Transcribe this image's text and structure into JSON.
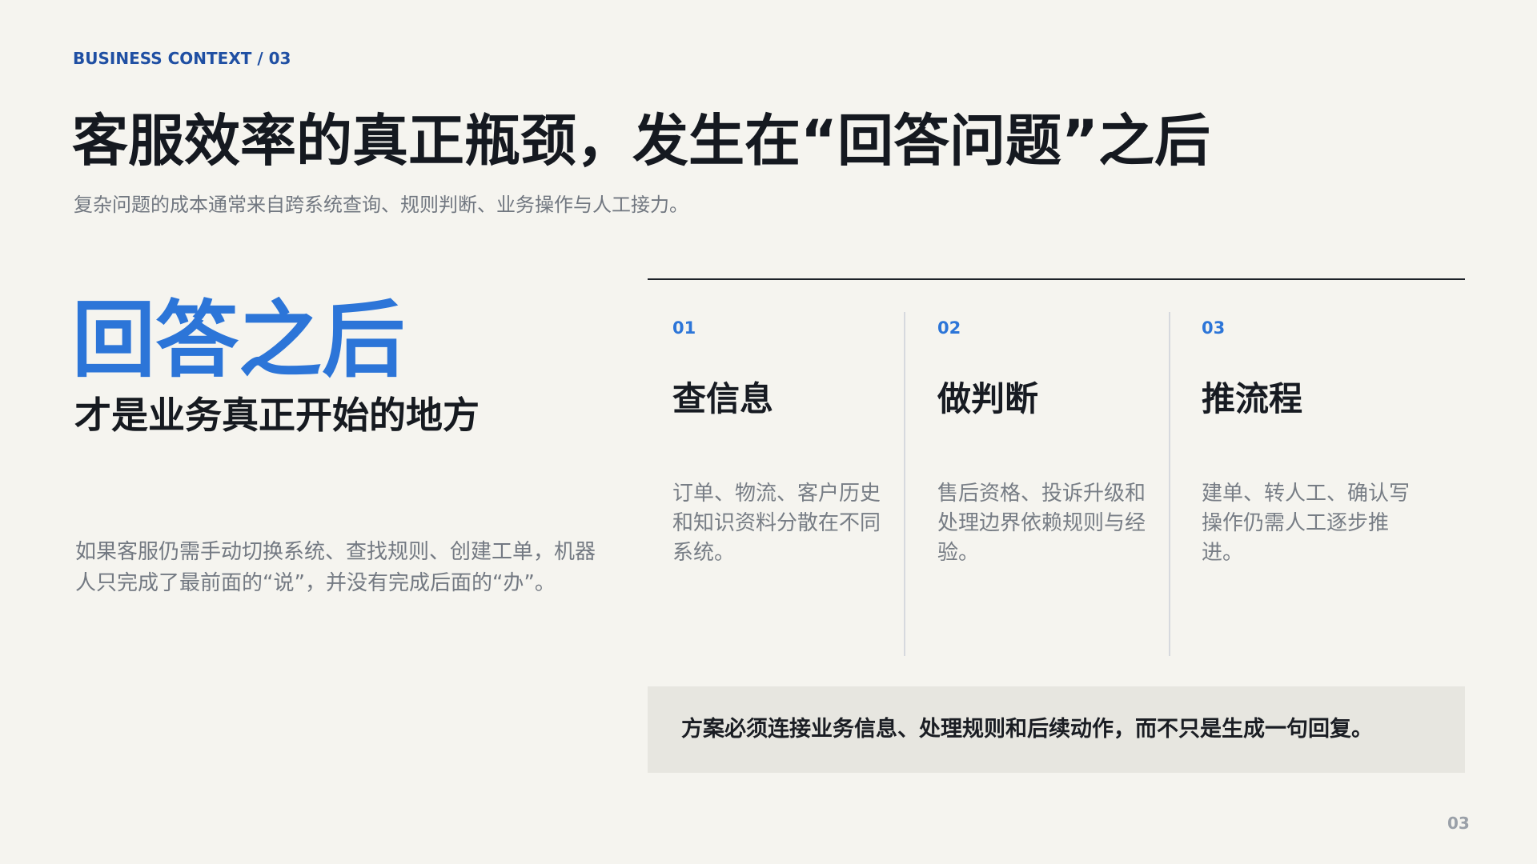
{
  "header": {
    "eyebrow": "BUSINESS CONTEXT / 03",
    "title": "客服效率的真正瓶颈，发生在“回答问题”之后",
    "subtitle": "复杂问题的成本通常来自跨系统查询、规则判断、业务操作与人工接力。"
  },
  "left_panel": {
    "highlight": "回答之后",
    "subheading": "才是业务真正开始的地方",
    "body": "如果客服仍需手动切换系统、查找规则、创建工单，机器人只完成了最前面的“说”，并没有完成后面的“办”。"
  },
  "steps": [
    {
      "number": "01",
      "title": "查信息",
      "description": "订单、物流、客户历史和知识资料分散在不同系统。"
    },
    {
      "number": "02",
      "title": "做判断",
      "description": "售后资格、投诉升级和处理边界依赖规则与经验。"
    },
    {
      "number": "03",
      "title": "推流程",
      "description": "建单、转人工、确认写操作仍需人工逐步推进。"
    }
  ],
  "callout": {
    "text": "方案必须连接业务信息、处理规则和后续动作，而不只是生成一句回复。"
  },
  "footer": {
    "page_number": "03"
  },
  "colors": {
    "background": "#f5f4ef",
    "accent": "#2c75d8",
    "eyebrow": "#1f4fa3",
    "callout_background": "#e7e6e0",
    "text_dark": "#16191e",
    "text_muted": "#737982"
  }
}
